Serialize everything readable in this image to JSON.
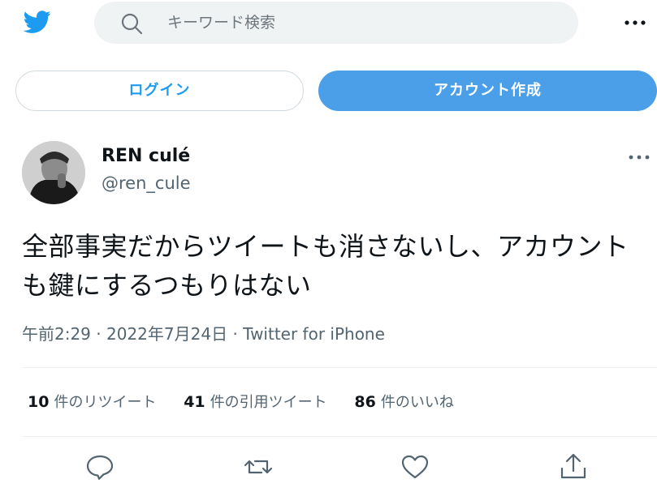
{
  "header": {
    "logo_icon": "twitter-bird-icon",
    "search": {
      "placeholder": "キーワード検索",
      "icon": "search-icon"
    },
    "more_icon": "more-horizontal-icon"
  },
  "auth": {
    "login_label": "ログイン",
    "signup_label": "アカウント作成"
  },
  "tweet": {
    "author": {
      "display_name": "REN culé",
      "handle": "@ren_cule"
    },
    "text": "全部事実だからツイートも消さないし、アカウントも鍵にするつもりはない",
    "time": "午前2:29",
    "date": "2022年7月24日",
    "source": "Twitter for iPhone",
    "stats": {
      "retweets": {
        "count": "10",
        "label": "件のリツイート"
      },
      "quotes": {
        "count": "41",
        "label": "件の引用ツイート"
      },
      "likes": {
        "count": "86",
        "label": "件のいいね"
      }
    },
    "actions": [
      "reply-icon",
      "retweet-icon",
      "like-icon",
      "share-icon"
    ]
  },
  "colors": {
    "accent": "#1d9bf0",
    "signup_bg": "#4a9fe8",
    "search_bg": "#eff3f4",
    "muted": "#536471"
  }
}
